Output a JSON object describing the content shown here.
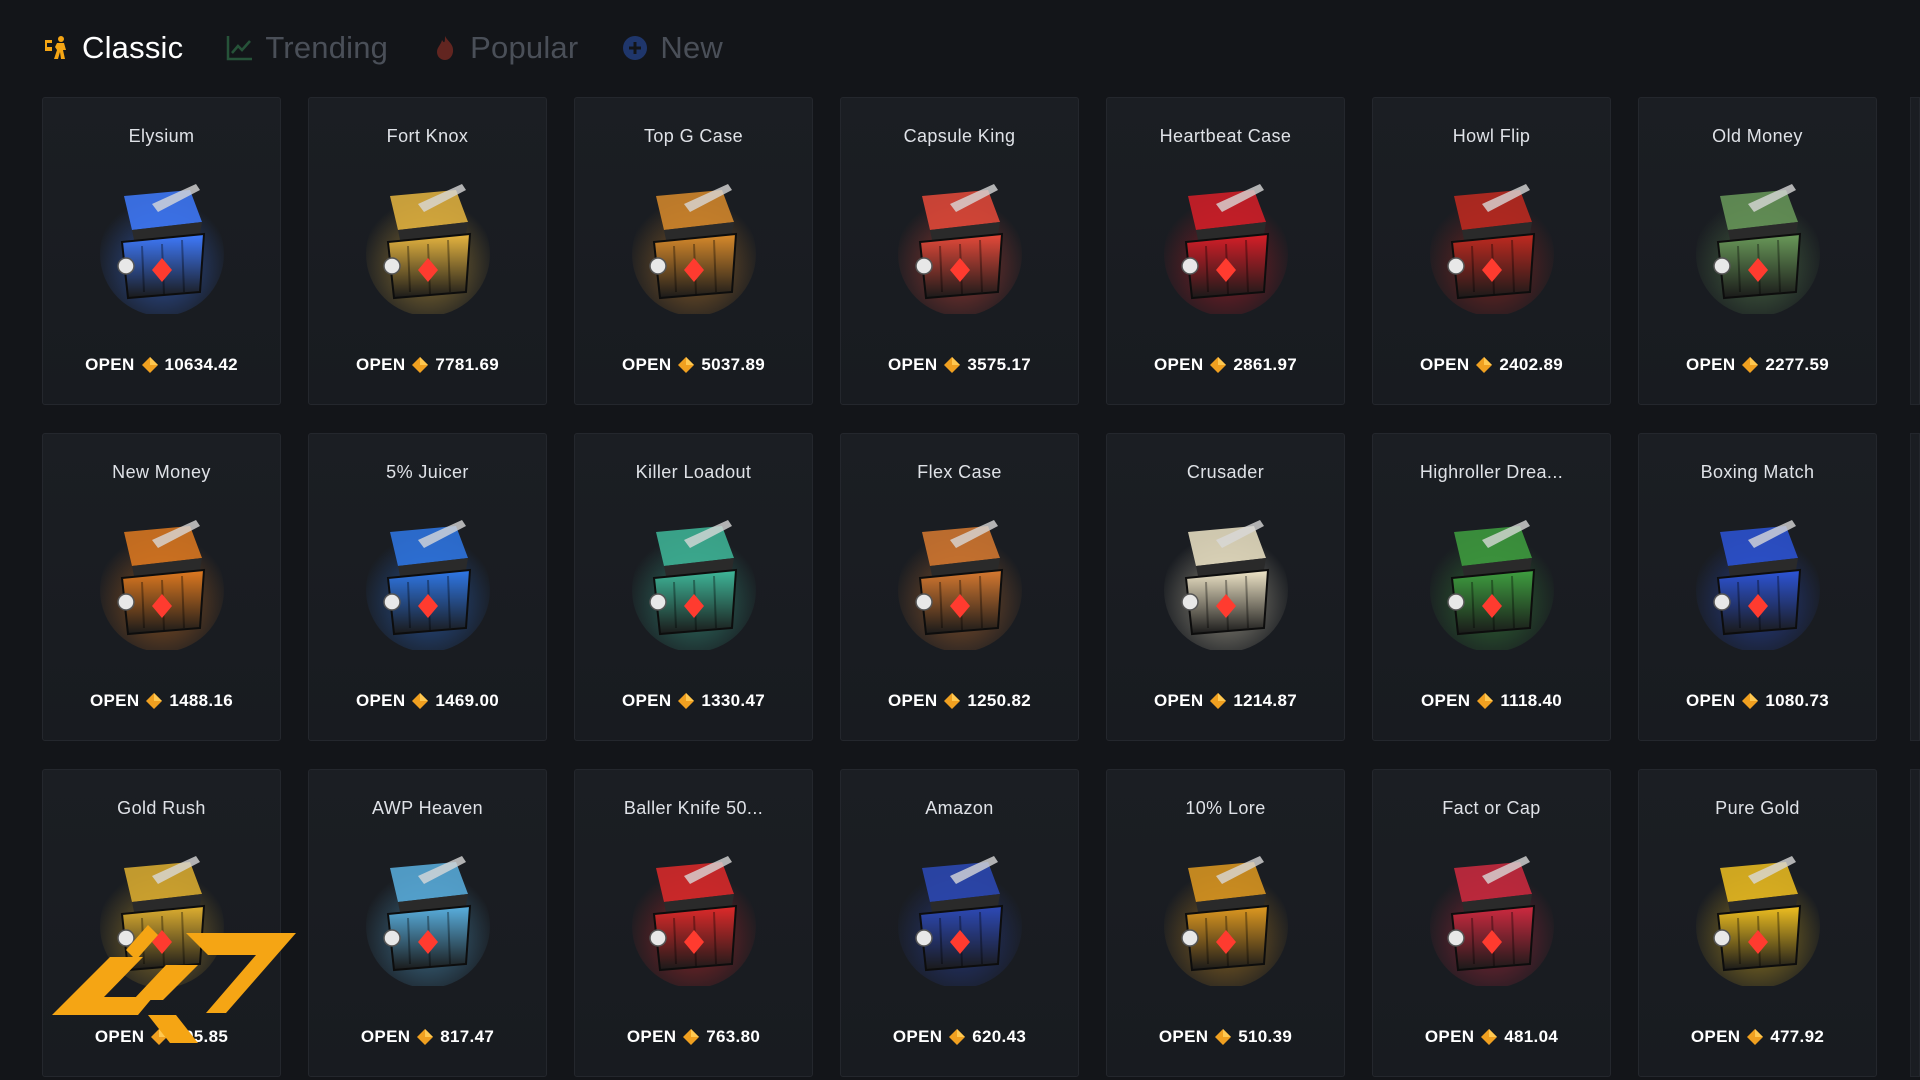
{
  "tabs": [
    {
      "label": "Classic",
      "active": true,
      "icon": "cs-icon"
    },
    {
      "label": "Trending",
      "active": false,
      "icon": "trending-chart-icon"
    },
    {
      "label": "Popular",
      "active": false,
      "icon": "fire-icon"
    },
    {
      "label": "New",
      "active": false,
      "icon": "plus-circle-icon"
    }
  ],
  "open_label": "OPEN",
  "currency_icon": "coin-diamond-icon",
  "colors": {
    "background": "#131519",
    "card": "#1b1e23",
    "coin": "#f0a020",
    "inactive_tab": "#4a4f58",
    "logo": "#f5a514"
  },
  "cases": [
    {
      "name": "Elysium",
      "price": "10634.42",
      "accent": "#3f7bff"
    },
    {
      "name": "Fort Knox",
      "price": "7781.69",
      "accent": "#e8b640"
    },
    {
      "name": "Top G Case",
      "price": "5037.89",
      "accent": "#d98b2b"
    },
    {
      "name": "Capsule King",
      "price": "3575.17",
      "accent": "#e84a3a"
    },
    {
      "name": "Heartbeat Case",
      "price": "2861.97",
      "accent": "#d81e28"
    },
    {
      "name": "Howl Flip",
      "price": "2402.89",
      "accent": "#c22a20"
    },
    {
      "name": "Old Money",
      "price": "2277.59",
      "accent": "#6a9a5a"
    },
    {
      "name": "New Money",
      "price": "1488.16",
      "accent": "#e07a20"
    },
    {
      "name": "5% Juicer",
      "price": "1469.00",
      "accent": "#2f78e8"
    },
    {
      "name": "Killer Loadout",
      "price": "1330.47",
      "accent": "#3fb89a"
    },
    {
      "name": "Flex Case",
      "price": "1250.82",
      "accent": "#d87a30"
    },
    {
      "name": "Crusader",
      "price": "1214.87",
      "accent": "#f0e6c8"
    },
    {
      "name": "Highroller Drea...",
      "price": "1118.40",
      "accent": "#3fa040"
    },
    {
      "name": "Boxing Match",
      "price": "1080.73",
      "accent": "#2d55d8"
    },
    {
      "name": "Gold Rush",
      "price": "995.85",
      "accent": "#e0b030"
    },
    {
      "name": "AWP Heaven",
      "price": "817.47",
      "accent": "#5ab0e0"
    },
    {
      "name": "Baller Knife 50...",
      "price": "763.80",
      "accent": "#e02a2a"
    },
    {
      "name": "Amazon",
      "price": "620.43",
      "accent": "#2d4ab8"
    },
    {
      "name": "10% Lore",
      "price": "510.39",
      "accent": "#e09a20"
    },
    {
      "name": "Fact or Cap",
      "price": "481.04",
      "accent": "#d02a40"
    },
    {
      "name": "Pure Gold",
      "price": "477.92",
      "accent": "#f0c020"
    }
  ],
  "watermark": {
    "icon": "site-logo-icon"
  }
}
